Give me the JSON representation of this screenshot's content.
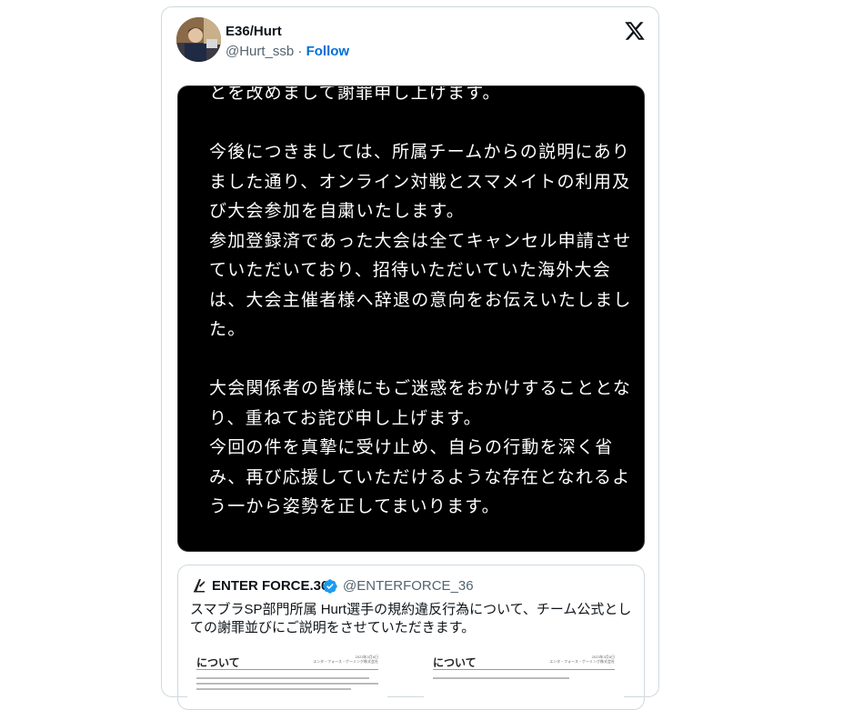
{
  "tweet": {
    "author_name": "E36/Hurt",
    "author_handle": "@Hurt_ssb",
    "separator": "·",
    "follow_label": "Follow"
  },
  "media": {
    "text": "とを改めまして謝罪申し上げます。\n\n今後につきましては、所属チームからの説明にありました通り、オンライン対戦とスマメイトの利用及び大会参加を自粛いたします。\n参加登録済であった大会は全てキャンセル申請させていただいており、招待いただいていた海外大会は、大会主催者様へ辞退の意向をお伝えいたしました。\n\n大会関係者の皆様にもご迷惑をおかけすることとなり、重ねてお詫び申し上げます。\n今回の件を真摯に受け止め、自らの行動を深く省み、再び応援していただけるような存在となれるよう一から姿勢を正してまいります。"
  },
  "quote": {
    "name": "ENTER FORCE.36",
    "handle": "@ENTERFORCE_36",
    "text": "スマブラSP部門所属 Hurt選手の規約違反行為について、チーム公式としての謝罪並びにご説明をさせていただきます。",
    "doc_left_title": "について",
    "doc_right_title": "について",
    "doc_meta_line1": "2023年3月6日",
    "doc_meta_line2": "エンタ・フォース・ゲーミング株式会社"
  },
  "colors": {
    "link": "#006fd6",
    "muted": "#536471",
    "verified": "#1d9bf0",
    "border": "#cfd9de"
  }
}
